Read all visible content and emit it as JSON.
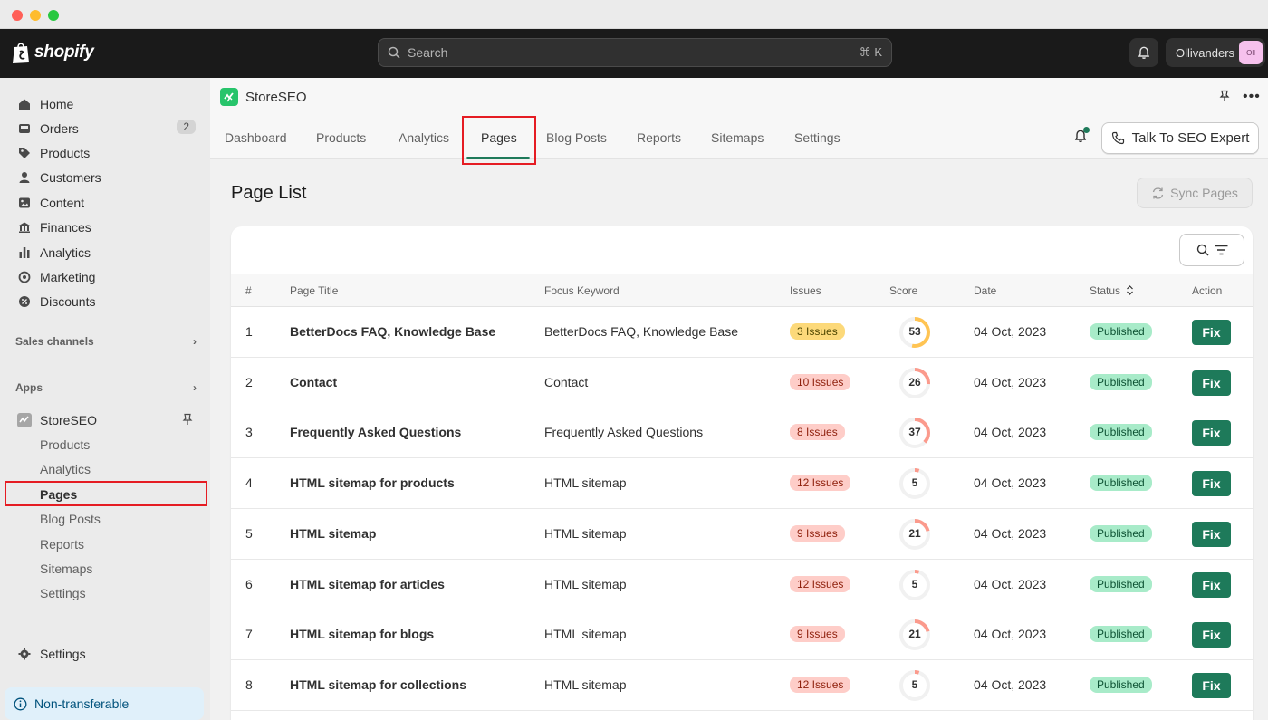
{
  "top": {
    "logo_text": "shopify",
    "search_placeholder": "Search",
    "search_shortcut": "⌘ K",
    "store_name": "Ollivanders",
    "store_avatar": "Oll"
  },
  "sidebar": {
    "items": [
      {
        "label": "Home",
        "icon": "home-icon"
      },
      {
        "label": "Orders",
        "icon": "inbox-icon",
        "badge": "2"
      },
      {
        "label": "Products",
        "icon": "tag-icon"
      },
      {
        "label": "Customers",
        "icon": "person-icon"
      },
      {
        "label": "Content",
        "icon": "content-icon"
      },
      {
        "label": "Finances",
        "icon": "bank-icon"
      },
      {
        "label": "Analytics",
        "icon": "bar-chart-icon"
      },
      {
        "label": "Marketing",
        "icon": "target-icon"
      },
      {
        "label": "Discounts",
        "icon": "discount-icon"
      }
    ],
    "sales_channels": "Sales channels",
    "apps": "Apps",
    "app_name": "StoreSEO",
    "app_subitems": [
      "Products",
      "Analytics",
      "Pages",
      "Blog Posts",
      "Reports",
      "Sitemaps",
      "Settings"
    ],
    "settings": "Settings",
    "non_transferable": "Non-transferable"
  },
  "app": {
    "title": "StoreSEO",
    "tabs": [
      "Dashboard",
      "Products",
      "Analytics",
      "Pages",
      "Blog Posts",
      "Reports",
      "Sitemaps",
      "Settings"
    ],
    "talk_button": "Talk To SEO Expert"
  },
  "page": {
    "title": "Page List",
    "sync_button": "Sync Pages",
    "columns": [
      "#",
      "Page Title",
      "Focus Keyword",
      "Issues",
      "Score",
      "Date",
      "Status",
      "Action"
    ],
    "rows": [
      {
        "num": "1",
        "title": "BetterDocs FAQ, Knowledge Base",
        "keyword": "BetterDocs FAQ, Knowledge Base",
        "issues": "3 Issues",
        "score": "53",
        "date": "04 Oct, 2023",
        "status": "Published",
        "action": "Fix"
      },
      {
        "num": "2",
        "title": "Contact",
        "keyword": "Contact",
        "issues": "10 Issues",
        "score": "26",
        "date": "04 Oct, 2023",
        "status": "Published",
        "action": "Fix"
      },
      {
        "num": "3",
        "title": "Frequently Asked Questions",
        "keyword": "Frequently Asked Questions",
        "issues": "8 Issues",
        "score": "37",
        "date": "04 Oct, 2023",
        "status": "Published",
        "action": "Fix"
      },
      {
        "num": "4",
        "title": "HTML sitemap for products",
        "keyword": "HTML sitemap",
        "issues": "12 Issues",
        "score": "5",
        "date": "04 Oct, 2023",
        "status": "Published",
        "action": "Fix"
      },
      {
        "num": "5",
        "title": "HTML sitemap",
        "keyword": "HTML sitemap",
        "issues": "9 Issues",
        "score": "21",
        "date": "04 Oct, 2023",
        "status": "Published",
        "action": "Fix"
      },
      {
        "num": "6",
        "title": "HTML sitemap for articles",
        "keyword": "HTML sitemap",
        "issues": "12 Issues",
        "score": "5",
        "date": "04 Oct, 2023",
        "status": "Published",
        "action": "Fix"
      },
      {
        "num": "7",
        "title": "HTML sitemap for blogs",
        "keyword": "HTML sitemap",
        "issues": "9 Issues",
        "score": "21",
        "date": "04 Oct, 2023",
        "status": "Published",
        "action": "Fix"
      },
      {
        "num": "8",
        "title": "HTML sitemap for collections",
        "keyword": "HTML sitemap",
        "issues": "12 Issues",
        "score": "5",
        "date": "04 Oct, 2023",
        "status": "Published",
        "action": "Fix"
      }
    ]
  },
  "colors": {
    "accent_green": "#1e7a5a",
    "issue_warning": "#fcd97a",
    "issue_critical": "#fecdc8",
    "status_published": "#a8ebc9",
    "score_ring_warning": "#ffc453",
    "score_ring_critical": "#fb9a8c",
    "highlight_red": "#e51c23"
  }
}
